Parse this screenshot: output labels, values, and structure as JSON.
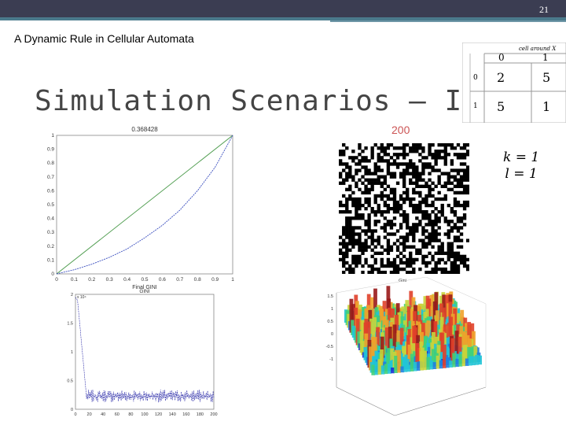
{
  "slide": {
    "number": "21",
    "header": "A Dynamic Rule in Cellular Automata",
    "title": "Simulation Scenarios – I.C.",
    "frame_label": "200",
    "params": [
      "k = 1",
      "l = 1"
    ]
  },
  "table": {
    "title": "cell around X",
    "col_headers": [
      "0",
      "1"
    ],
    "row_headers": [
      "0",
      "1"
    ],
    "cells": [
      [
        "2",
        "5"
      ],
      [
        "5",
        "1"
      ]
    ]
  },
  "chart_data": [
    {
      "type": "line",
      "title": "0.368428",
      "xlabel": "Final GINI",
      "xlim": [
        0,
        1
      ],
      "ylim": [
        0,
        1
      ],
      "x_ticks": [
        "0",
        "0.1",
        "0.2",
        "0.3",
        "0.4",
        "0.5",
        "0.6",
        "0.7",
        "0.8",
        "0.9",
        "1"
      ],
      "y_ticks": [
        "0",
        "0.1",
        "0.2",
        "0.3",
        "0.4",
        "0.5",
        "0.6",
        "0.7",
        "0.8",
        "0.9",
        "1"
      ],
      "series": [
        {
          "values": [
            [
              0,
              0
            ],
            [
              1,
              1
            ]
          ],
          "color": "#4a9a4a"
        },
        {
          "values": [
            [
              0,
              0
            ],
            [
              0.1,
              0.03
            ],
            [
              0.2,
              0.07
            ],
            [
              0.3,
              0.12
            ],
            [
              0.4,
              0.18
            ],
            [
              0.5,
              0.26
            ],
            [
              0.6,
              0.35
            ],
            [
              0.7,
              0.46
            ],
            [
              0.8,
              0.6
            ],
            [
              0.9,
              0.77
            ],
            [
              1,
              1
            ]
          ],
          "color": "#3b4fbf"
        }
      ]
    },
    {
      "type": "line",
      "title": "GINI",
      "xlim": [
        0,
        200
      ],
      "ylim": [
        0,
        2
      ],
      "x_ticks": [
        "0",
        "20",
        "40",
        "60",
        "80",
        "100",
        "120",
        "140",
        "160",
        "180",
        "200"
      ],
      "y_ticks": [
        "0",
        "0.5",
        "1",
        "1.5",
        "2"
      ],
      "series": [
        {
          "color": "#2a2aa8"
        }
      ]
    },
    {
      "type": "area",
      "title": "Gini",
      "zticks": [
        "-1",
        "-0.5",
        "0",
        "0.5",
        "1",
        "1.5"
      ]
    }
  ]
}
